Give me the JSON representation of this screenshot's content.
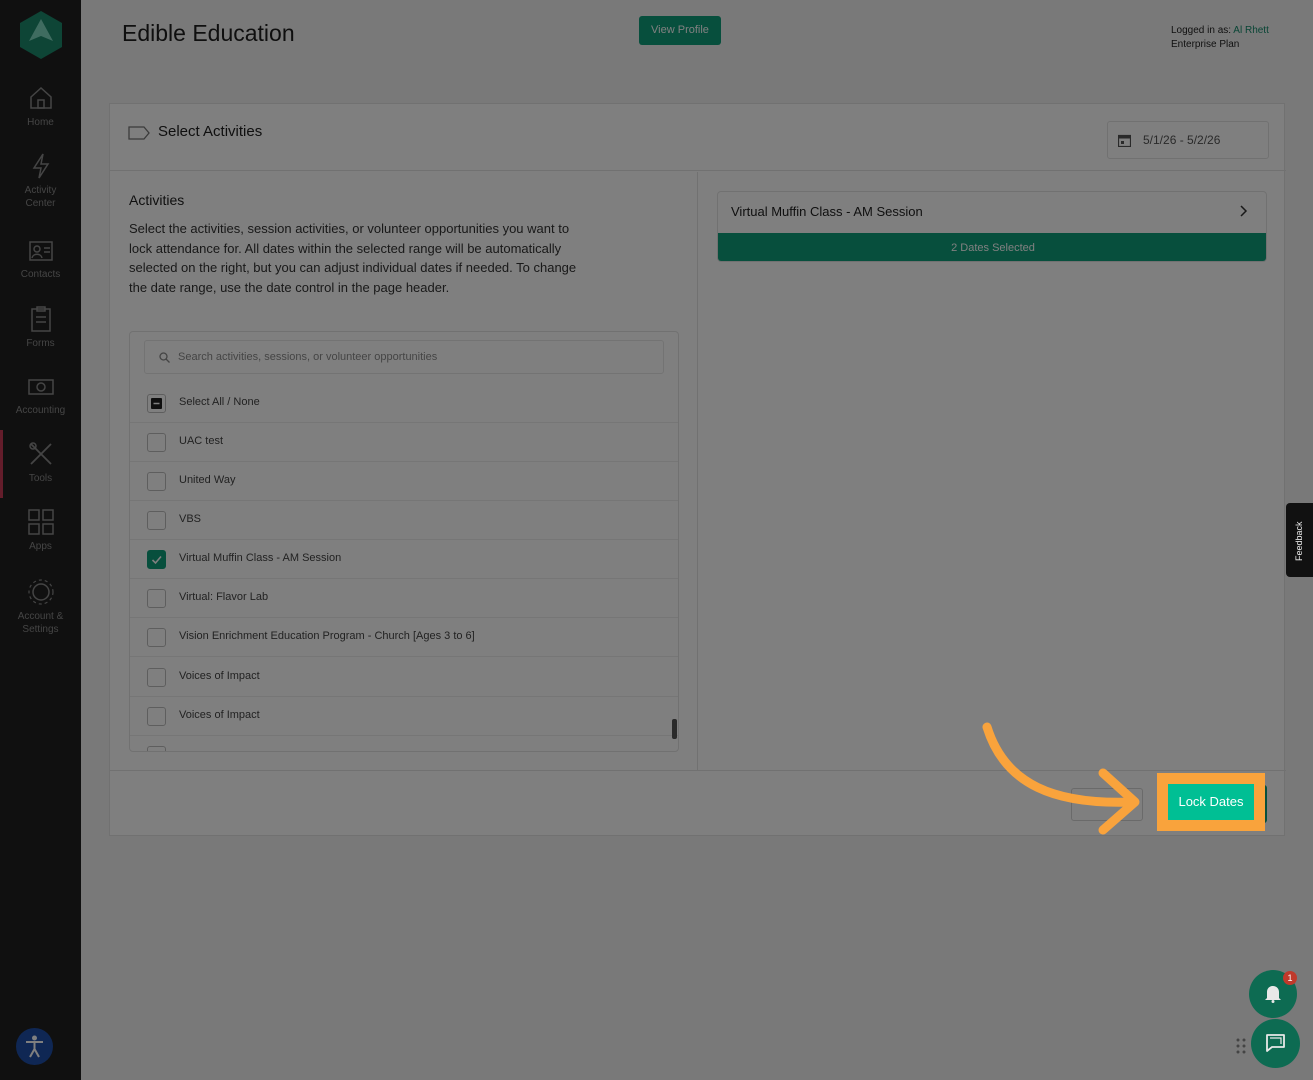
{
  "sidebar": {
    "items": [
      {
        "label": "Home",
        "icon": "home-icon"
      },
      {
        "label": "Activity Center",
        "icon": "lightning-icon"
      },
      {
        "label": "Contacts",
        "icon": "contacts-icon"
      },
      {
        "label": "Forms",
        "icon": "clipboard-icon"
      },
      {
        "label": "Accounting",
        "icon": "money-icon"
      },
      {
        "label": "Tools",
        "icon": "tools-icon"
      },
      {
        "label": "Apps",
        "icon": "apps-grid-icon"
      },
      {
        "label": "Account & Settings",
        "icon": "gear-icon"
      }
    ],
    "active": "Tools"
  },
  "header": {
    "title": "Edible Education",
    "view_profile": "View Profile",
    "logged_in_prefix": "Logged in as:",
    "user": "Al Rhett",
    "plan": "Enterprise Plan"
  },
  "card": {
    "title": "Select Activities",
    "date_range": "5/1/26 - 5/2/26"
  },
  "activities": {
    "heading": "Activities",
    "description": "Select the activities, session activities, or volunteer opportunities you want to lock attendance for. All dates within the selected range will be automatically selected on the right, but you can adjust individual dates if needed. To change the date range, use the date control in the page header.",
    "search_placeholder": "Search activities, sessions, or volunteer opportunities",
    "select_all": "Select All / None",
    "items": [
      {
        "label": "UAC test",
        "checked": false
      },
      {
        "label": "United Way",
        "checked": false
      },
      {
        "label": "VBS",
        "checked": false
      },
      {
        "label": "Virtual Muffin Class - AM Session",
        "checked": true
      },
      {
        "label": "Virtual: Flavor Lab",
        "checked": false
      },
      {
        "label": "Vision Enrichment Education Program - Church [Ages 3 to 6]",
        "checked": false
      },
      {
        "label": "Voices of Impact",
        "checked": false
      },
      {
        "label": "Voices of Impact",
        "checked": false
      }
    ]
  },
  "selected": {
    "title": "Virtual Muffin Class - AM Session",
    "dates": "2 Dates Selected"
  },
  "footer": {
    "lock_button": "Lock Dates"
  },
  "feedback": "Feedback",
  "notifications": {
    "count": "1"
  },
  "colors": {
    "accent": "#0e9e7b",
    "highlight": "#f9a33c",
    "sidebar": "#212121"
  }
}
